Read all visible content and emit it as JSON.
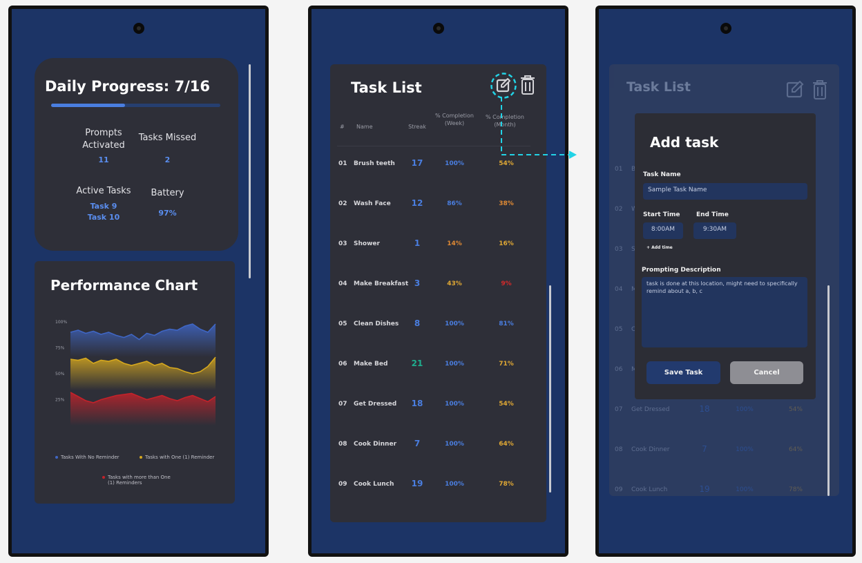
{
  "dashboard": {
    "title": "Daily Progress: 7/16",
    "progress_fraction": 0.4375,
    "stats": {
      "prompts_label": "Prompts Activated",
      "prompts_value": "11",
      "missed_label": "Tasks Missed",
      "missed_value": "2",
      "active_label": "Active Tasks",
      "active_values": [
        "Task 9",
        "Task 10"
      ],
      "battery_label": "Battery",
      "battery_value": "97%"
    }
  },
  "performance": {
    "title": "Performance Chart",
    "chart_data": {
      "type": "area",
      "ytick_labels": [
        "100%",
        "75%",
        "50%",
        "25%"
      ],
      "ylim": [
        0,
        100
      ],
      "series": [
        {
          "name": "Tasks With No Reminder",
          "color": "#3f66c4",
          "values": [
            90,
            92,
            89,
            91,
            88,
            90,
            87,
            85,
            88,
            83,
            89,
            87,
            91,
            93,
            92,
            96,
            98,
            93,
            90,
            98
          ]
        },
        {
          "name": "Tasks with One (1) Reminder",
          "color": "#d6a81e",
          "values": [
            64,
            63,
            65,
            60,
            63,
            62,
            64,
            60,
            58,
            60,
            62,
            58,
            60,
            56,
            55,
            52,
            50,
            52,
            57,
            66
          ]
        },
        {
          "name": "Tasks with more than One (1) Reminders",
          "color": "#c4222a",
          "values": [
            32,
            28,
            24,
            22,
            25,
            27,
            29,
            30,
            31,
            28,
            25,
            27,
            29,
            26,
            24,
            27,
            29,
            26,
            23,
            28
          ]
        }
      ]
    }
  },
  "task_list": {
    "title": "Task List",
    "headers": {
      "num": "#",
      "name": "Name",
      "streak": "Streak",
      "week": "% Completion (Week)",
      "month": "% Completion (Month)"
    },
    "rows": [
      {
        "num": "01",
        "name": "Brush teeth",
        "streak": "17",
        "week": "100%",
        "month": "54%",
        "streak_color": "#4a7ee0",
        "week_color": "#4a7ee0",
        "month_color": "#e0a834"
      },
      {
        "num": "02",
        "name": "Wash Face",
        "streak": "12",
        "week": "86%",
        "month": "38%",
        "streak_color": "#4a7ee0",
        "week_color": "#4a7ee0",
        "month_color": "#e08a34"
      },
      {
        "num": "03",
        "name": "Shower",
        "streak": "1",
        "week": "14%",
        "month": "16%",
        "streak_color": "#4a7ee0",
        "week_color": "#e08a34",
        "month_color": "#e0a834"
      },
      {
        "num": "04",
        "name": "Make Breakfast",
        "streak": "3",
        "week": "43%",
        "month": "9%",
        "streak_color": "#4a7ee0",
        "week_color": "#e0a834",
        "month_color": "#d42a2a"
      },
      {
        "num": "05",
        "name": "Clean Dishes",
        "streak": "8",
        "week": "100%",
        "month": "81%",
        "streak_color": "#4a7ee0",
        "week_color": "#4a7ee0",
        "month_color": "#4a7ee0"
      },
      {
        "num": "06",
        "name": "Make Bed",
        "streak": "21",
        "week": "100%",
        "month": "71%",
        "streak_color": "#1fae8e",
        "week_color": "#4a7ee0",
        "month_color": "#e0a834"
      },
      {
        "num": "07",
        "name": "Get Dressed",
        "streak": "18",
        "week": "100%",
        "month": "54%",
        "streak_color": "#4a7ee0",
        "week_color": "#4a7ee0",
        "month_color": "#e0a834"
      },
      {
        "num": "08",
        "name": "Cook Dinner",
        "streak": "7",
        "week": "100%",
        "month": "64%",
        "streak_color": "#4a7ee0",
        "week_color": "#4a7ee0",
        "month_color": "#e0a834"
      },
      {
        "num": "09",
        "name": "Cook Lunch",
        "streak": "19",
        "week": "100%",
        "month": "78%",
        "streak_color": "#4a7ee0",
        "week_color": "#4a7ee0",
        "month_color": "#e0a834"
      }
    ]
  },
  "add_task": {
    "title": "Add task",
    "task_name_label": "Task Name",
    "task_name_value": "Sample Task Name",
    "start_time_label": "Start Time",
    "start_time_value": "8:00AM",
    "end_time_label": "End Time",
    "end_time_value": "9:30AM",
    "add_time_label": "+ Add time",
    "description_label": "Prompting Description",
    "description_value": "task is done at this location, might need to specifically remind about a, b, c",
    "save_label": "Save Task",
    "cancel_label": "Cancel"
  },
  "colors": {
    "screen_bg": "#1c3466",
    "card_bg": "#2e2f38",
    "accent_blue": "#4a7ee0",
    "highlight_cyan": "#22d3e6"
  }
}
